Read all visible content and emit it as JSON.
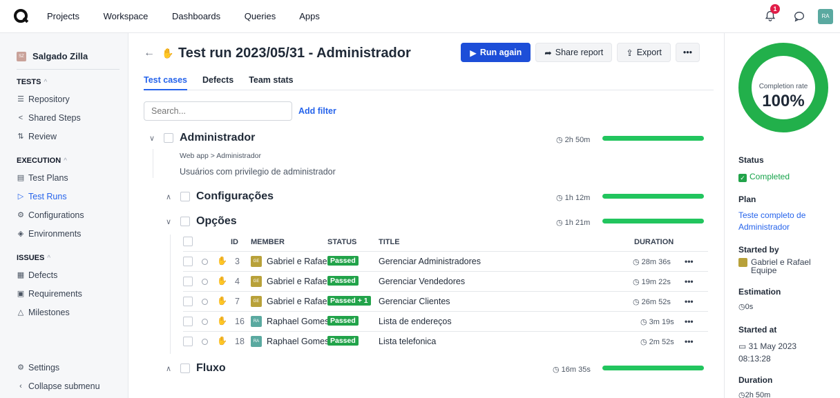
{
  "nav": {
    "items": [
      "Projects",
      "Workspace",
      "Dashboards",
      "Queries",
      "Apps"
    ],
    "notif_count": "1",
    "user_initials": "RA"
  },
  "sidebar": {
    "project_initials": "SZ",
    "project_name": "Salgado Zilla",
    "sections": [
      {
        "title": "TESTS",
        "items": [
          "Repository",
          "Shared Steps",
          "Review"
        ]
      },
      {
        "title": "EXECUTION",
        "items": [
          "Test Plans",
          "Test Runs",
          "Configurations",
          "Environments"
        ]
      },
      {
        "title": "ISSUES",
        "items": [
          "Defects",
          "Requirements",
          "Milestones"
        ]
      }
    ],
    "settings": "Settings",
    "collapse": "Collapse submenu"
  },
  "header": {
    "title": "Test run 2023/05/31 - Administrador",
    "run_again": "Run again",
    "share": "Share report",
    "export": "Export",
    "more": "•••"
  },
  "tabs": [
    "Test cases",
    "Defects",
    "Team stats"
  ],
  "search": {
    "placeholder": "Search...",
    "add_filter": "Add filter"
  },
  "suite": {
    "name": "Administrador",
    "duration": "2h 50m",
    "path": "Web app > Administrador",
    "description": "Usuários com privilegio de administrador"
  },
  "groups": [
    {
      "name": "Configurações",
      "duration": "1h 12m",
      "progress": 100
    },
    {
      "name": "Opções",
      "duration": "1h 21m",
      "progress": 100
    },
    {
      "name": "Fluxo",
      "duration": "16m 35s",
      "progress": 100
    }
  ],
  "table": {
    "headers": {
      "id": "ID",
      "member": "MEMBER",
      "status": "STATUS",
      "title": "TITLE",
      "duration": "DURATION"
    },
    "rows": [
      {
        "id": "3",
        "initials": "GE",
        "member": "Gabriel e Rafael Equipe",
        "status": "Passed",
        "title": "Gerenciar Administradores",
        "duration": "28m 36s"
      },
      {
        "id": "4",
        "initials": "GE",
        "member": "Gabriel e Rafael Equipe",
        "status": "Passed",
        "title": "Gerenciar Vendedores",
        "duration": "19m 22s"
      },
      {
        "id": "7",
        "initials": "GE",
        "member": "Gabriel e Rafael Equipe",
        "status": "Passed + 1",
        "title": "Gerenciar Clientes",
        "duration": "26m 52s"
      },
      {
        "id": "16",
        "initials": "RA",
        "member": "Raphael Gomes",
        "status": "Passed",
        "title": "Lista de endereços",
        "duration": "3m 19s"
      },
      {
        "id": "18",
        "initials": "RA",
        "member": "Raphael Gomes",
        "status": "Passed",
        "title": "Lista telefonica",
        "duration": "2m 52s"
      }
    ]
  },
  "panel": {
    "completion_label": "Completion rate",
    "completion_value": "100%",
    "status_label": "Status",
    "status_value": "Completed",
    "plan_label": "Plan",
    "plan_value": "Teste completo de Administrador",
    "started_by_label": "Started by",
    "started_by_value": "Gabriel e Rafael Equipe",
    "estimation_label": "Estimation",
    "estimation_value": "0s",
    "started_at_label": "Started at",
    "started_at_value": "31 May 2023 08:13:28",
    "duration_label": "Duration",
    "duration_value": "2h 50m"
  },
  "colors": {
    "accent": "#2563eb",
    "primary_button": "#1d4ed8",
    "passed": "#22a34a",
    "progress": "#22c55e",
    "avatar_ge": "#b8a13a",
    "avatar_ra": "#5aa9a0"
  }
}
